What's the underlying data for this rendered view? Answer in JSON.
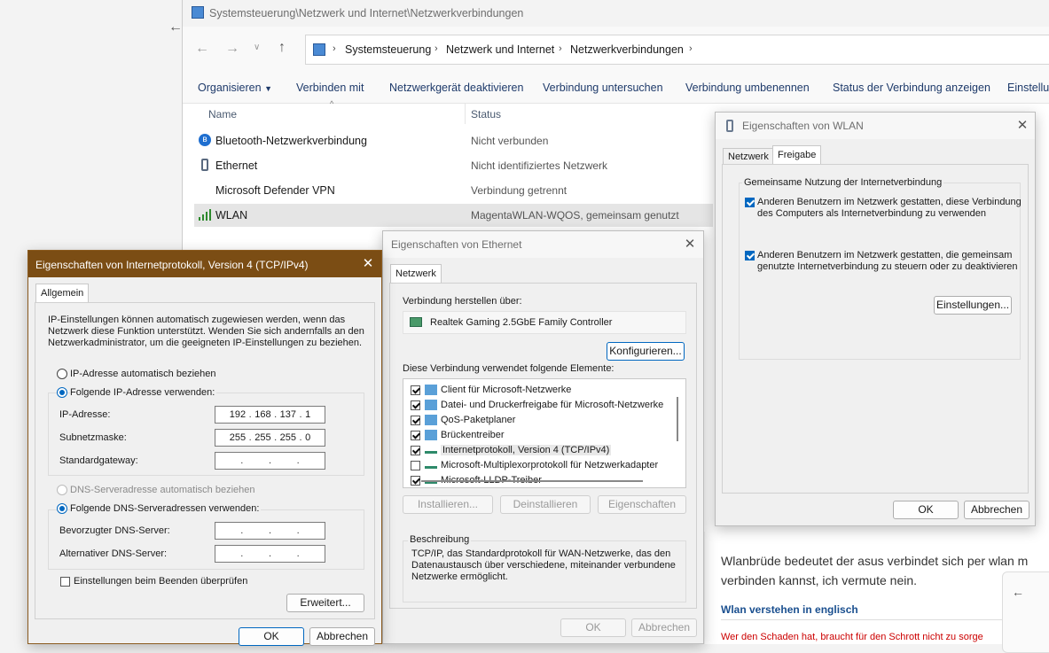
{
  "explorer": {
    "title": "Systemsteuerung\\Netzwerk und Internet\\Netzwerkverbindungen",
    "breadcrumb": [
      "Systemsteuerung",
      "Netzwerk und Internet",
      "Netzwerkverbindungen"
    ],
    "toolbar": [
      "Organisieren",
      "Verbinden mit",
      "Netzwerkgerät deaktivieren",
      "Verbindung untersuchen",
      "Verbindung umbenennen",
      "Status der Verbindung anzeigen",
      "Einstellun"
    ],
    "columns": {
      "name": "Name",
      "status": "Status"
    },
    "rows": [
      {
        "name": "Bluetooth-Netzwerkverbindung",
        "status": "Nicht verbunden",
        "icon": "bluetooth-icon"
      },
      {
        "name": "Ethernet",
        "status": "Nicht identifiziertes Netzwerk",
        "icon": "ethernet-icon"
      },
      {
        "name": "Microsoft Defender VPN",
        "status": "Verbindung getrennt",
        "icon": "vpn-icon"
      },
      {
        "name": "WLAN",
        "status": "MagentaWLAN-WQOS, gemeinsam genutzt",
        "icon": "wifi-signal-icon"
      }
    ]
  },
  "ipv4": {
    "title": "Eigenschaften von Internetprotokoll, Version 4 (TCP/IPv4)",
    "tab": "Allgemein",
    "intro": [
      "IP-Einstellungen können automatisch zugewiesen werden, wenn das",
      "Netzwerk diese Funktion unterstützt. Wenden Sie sich andernfalls an den",
      "Netzwerkadministrator, um die geeigneten IP-Einstellungen zu beziehen."
    ],
    "radio_auto_ip": "IP-Adresse automatisch beziehen",
    "radio_manual_ip": "Folgende IP-Adresse verwenden:",
    "ip_label": "IP-Adresse:",
    "ip": [
      "192",
      "168",
      "137",
      "1"
    ],
    "subnet_label": "Subnetzmaske:",
    "subnet": [
      "255",
      "255",
      "255",
      "0"
    ],
    "gateway_label": "Standardgateway:",
    "radio_auto_dns": "DNS-Serveradresse automatisch beziehen",
    "radio_manual_dns": "Folgende DNS-Serveradressen verwenden:",
    "dns_pref_label": "Bevorzugter DNS-Server:",
    "dns_alt_label": "Alternativer DNS-Server:",
    "validate": "Einstellungen beim Beenden überprüfen",
    "advanced": "Erweitert...",
    "ok": "OK",
    "cancel": "Abbrechen"
  },
  "ethernet": {
    "title": "Eigenschaften von Ethernet",
    "tab": "Netzwerk",
    "connect_via": "Verbindung herstellen über:",
    "adapter": "Realtek Gaming 2.5GbE Family Controller",
    "configure": "Konfigurieren...",
    "uses_items": "Diese Verbindung verwendet folgende Elemente:",
    "items": [
      {
        "label": "Client für Microsoft-Netzwerke",
        "checked": true
      },
      {
        "label": "Datei- und Druckerfreigabe für Microsoft-Netzwerke",
        "checked": true
      },
      {
        "label": "QoS-Paketplaner",
        "checked": true
      },
      {
        "label": "Brückentreiber",
        "checked": true
      },
      {
        "label": "Internetprotokoll, Version 4 (TCP/IPv4)",
        "checked": true
      },
      {
        "label": "Microsoft-Multiplexorprotokoll für Netzwerkadapter",
        "checked": false
      },
      {
        "label": "Microsoft-LLDP-Treiber",
        "checked": true
      }
    ],
    "install": "Installieren...",
    "uninstall": "Deinstallieren",
    "properties": "Eigenschaften",
    "description_title": "Beschreibung",
    "description": [
      "TCP/IP, das Standardprotokoll für WAN-Netzwerke, das den",
      "Datenaustausch über verschiedene, miteinander verbundene",
      "Netzwerke ermöglicht."
    ],
    "ok": "OK",
    "cancel": "Abbrechen"
  },
  "wlan": {
    "title": "Eigenschaften von WLAN",
    "tab_network": "Netzwerk",
    "tab_sharing": "Freigabe",
    "group_title": "Gemeinsame Nutzung der Internetverbindung",
    "opt1": [
      "Anderen Benutzern im Netzwerk gestatten, diese Verbindung",
      "des Computers als Internetverbindung zu verwenden"
    ],
    "opt2": [
      "Anderen Benutzern im Netzwerk gestatten, die gemeinsam",
      "genutzte Internetverbindung zu steuern oder zu deaktivieren"
    ],
    "settings": "Einstellungen...",
    "ok": "OK",
    "cancel": "Abbrechen"
  },
  "background": {
    "text1": "Wlanbrüde bedeutet der asus verbindet sich per wlan m",
    "text2": "verbinden kannst, ich vermute nein.",
    "link": "Wlan verstehen in englisch",
    "red": "Wer den Schaden hat, braucht für den Schrott nicht zu sorge"
  }
}
